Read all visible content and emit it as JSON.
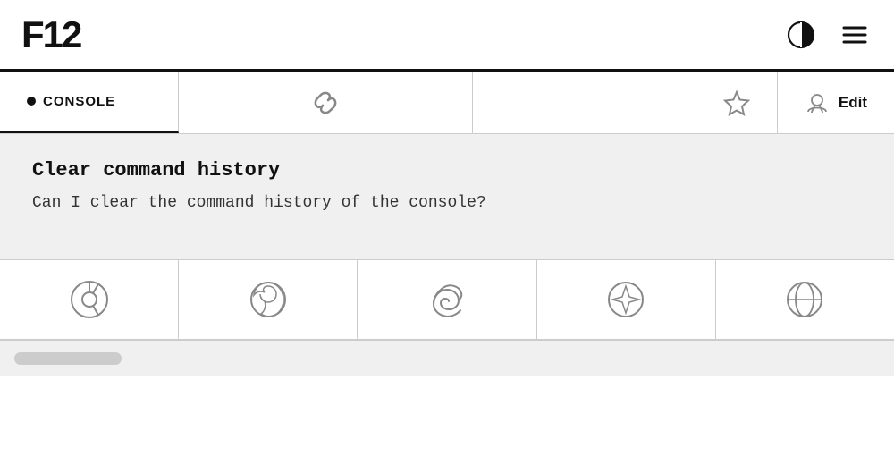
{
  "header": {
    "logo": "F12",
    "theme_icon_label": "theme-toggle-icon",
    "menu_icon_label": "hamburger-menu-icon"
  },
  "tab_bar": {
    "console_tab": {
      "label": "CONSOLE",
      "dot_active": true
    },
    "link_icon_label": "link-icon",
    "star_icon_label": "star-icon",
    "edit_label": "Edit",
    "edit_icon_label": "github-icon"
  },
  "content": {
    "title": "Clear command history",
    "body": "Can I clear the command history of the console?"
  },
  "browser_icons": [
    {
      "name": "chrome-icon",
      "label": "Chrome"
    },
    {
      "name": "firefox-icon",
      "label": "Firefox"
    },
    {
      "name": "edge-icon",
      "label": "Edge"
    },
    {
      "name": "safari-icon",
      "label": "Safari"
    },
    {
      "name": "opera-icon",
      "label": "Opera"
    }
  ],
  "bottom_bar": {
    "scroll_label": "scroll-track"
  }
}
